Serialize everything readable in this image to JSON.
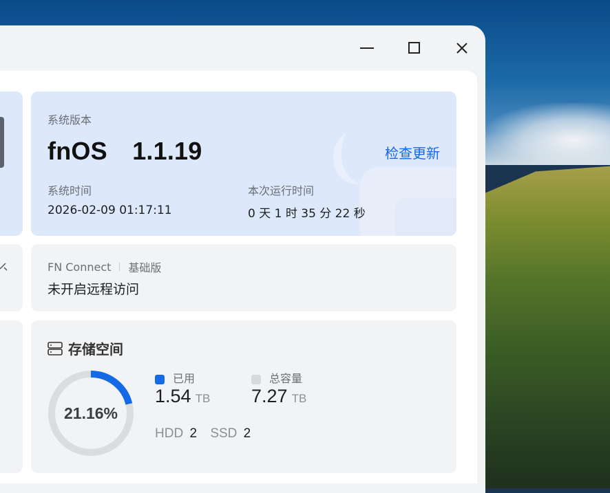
{
  "window_controls": {
    "minimize": "minimize-icon",
    "maximize": "maximize-icon",
    "close": "close-icon"
  },
  "system_card": {
    "version_label": "系统版本",
    "version_name": "fnOS  1.1.19",
    "check_update": "检查更新",
    "time_label": "系统时间",
    "time_value": "2026-02-09 01:17:11",
    "uptime_label": "本次运行时间",
    "uptime_value": "0 天 1 时 35 分 22 秒"
  },
  "fn_connect": {
    "title": "FN Connect",
    "edition": "基础版",
    "status": "未开启远程访问"
  },
  "storage": {
    "title": "存储空间",
    "percent_text": "21.16%",
    "used_fraction": 0.2116,
    "used_label": "已用",
    "used_value": "1.54",
    "used_unit": "TB",
    "total_label": "总容量",
    "total_value": "7.27",
    "total_unit": "TB",
    "hdd_label": "HDD",
    "hdd_count": "2",
    "ssd_label": "SSD",
    "ssd_count": "2",
    "colors": {
      "used": "#1469e6",
      "total": "#d7d9dd",
      "ring_track": "#dadcdf"
    }
  }
}
